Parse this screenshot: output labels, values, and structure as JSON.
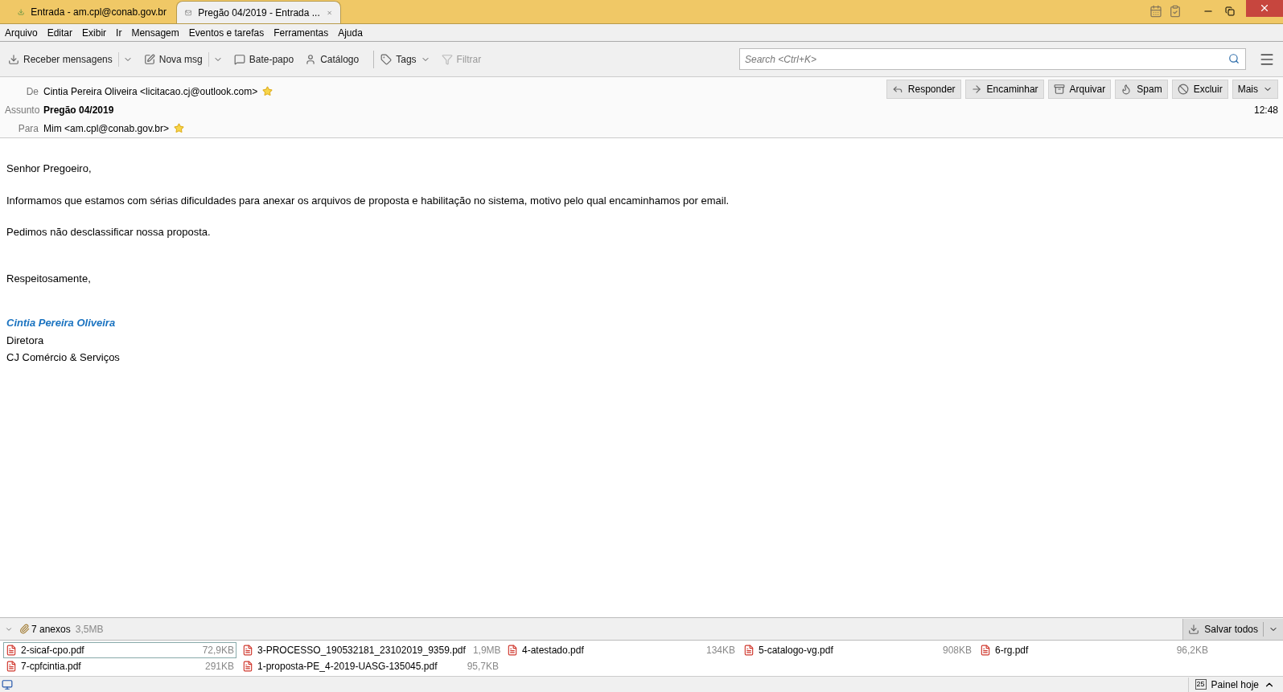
{
  "tabs": [
    {
      "label": "Entrada - am.cpl@conab.gov.br",
      "kind": "folder",
      "selected": false
    },
    {
      "label": "Pregão 04/2019 - Entrada ...",
      "kind": "message",
      "selected": true
    }
  ],
  "menu": [
    "Arquivo",
    "Editar",
    "Exibir",
    "Ir",
    "Mensagem",
    "Eventos e tarefas",
    "Ferramentas",
    "Ajuda"
  ],
  "toolbar": [
    {
      "label": "Receber mensagens",
      "kind": "download",
      "dropdown": true,
      "disabled": false
    },
    {
      "label": "Nova msg",
      "kind": "write",
      "dropdown": true,
      "disabled": false
    },
    {
      "label": "Bate-papo",
      "kind": "chat",
      "dropdown": false,
      "disabled": false
    },
    {
      "label": "Catálogo",
      "kind": "contact",
      "dropdown": false,
      "disabled": false
    },
    {
      "label": "Tags",
      "kind": "tag",
      "dropdown": true,
      "disabled": false
    },
    {
      "label": "Filtrar",
      "kind": "filter",
      "dropdown": false,
      "disabled": true
    }
  ],
  "search": {
    "placeholder": "Search <Ctrl+K>"
  },
  "header": {
    "fields": [
      {
        "label": "De",
        "value": "Cintia Pereira Oliveira <licitacao.cj@outlook.com>",
        "kind": "address"
      },
      {
        "label": "Assunto",
        "value": "Pregão 04/2019",
        "kind": "subject"
      },
      {
        "label": "Para",
        "value": "Mim <am.cpl@conab.gov.br>",
        "kind": "address"
      }
    ],
    "time": "12:48",
    "actions": [
      {
        "label": "Responder",
        "kind": "reply"
      },
      {
        "label": "Encaminhar",
        "kind": "forward"
      },
      {
        "label": "Arquivar",
        "kind": "archive"
      },
      {
        "label": "Spam",
        "kind": "spam"
      },
      {
        "label": "Excluir",
        "kind": "delete"
      },
      {
        "label": "Mais",
        "kind": "more"
      }
    ]
  },
  "body": [
    {
      "text": "Senhor Pregoeiro,",
      "kind": "paragraph"
    },
    {
      "text": "Informamos que estamos com sérias dificuldades para anexar os arquivos de proposta e habilitação no sistema, motivo pelo qual encaminhamos por email.",
      "kind": "paragraph"
    },
    {
      "text": "Pedimos não desclassificar nossa proposta.",
      "kind": "paragraph"
    },
    {
      "text": "Respeitosamente,",
      "kind": "closing"
    },
    {
      "text": "Cintia Pereira Oliveira",
      "kind": "signature-name"
    },
    {
      "text": "Diretora",
      "kind": "signature-line"
    },
    {
      "text": "CJ Comércio & Serviços",
      "kind": "signature-line"
    }
  ],
  "attachments": {
    "count": "7 anexos",
    "total": "3,5MB",
    "save_all": "Salvar todos",
    "items": [
      {
        "name": "2-sicaf-cpo.pdf",
        "size": "72,9KB",
        "selected": true
      },
      {
        "name": "3-PROCESSO_190532181_23102019_9359.pdf",
        "size": "1,9MB",
        "selected": false
      },
      {
        "name": "4-atestado.pdf",
        "size": "134KB",
        "selected": false
      },
      {
        "name": "5-catalogo-vg.pdf",
        "size": "908KB",
        "selected": false
      },
      {
        "name": "6-rg.pdf",
        "size": "96,2KB",
        "selected": false
      },
      {
        "name": "7-cpfcintia.pdf",
        "size": "291KB",
        "selected": false
      },
      {
        "name": "1-proposta-PE_4-2019-UASG-135045.pdf",
        "size": "95,7KB",
        "selected": false
      }
    ]
  },
  "status_bar": {
    "today_pane": "Painel hoje",
    "calendar_day": "25"
  }
}
